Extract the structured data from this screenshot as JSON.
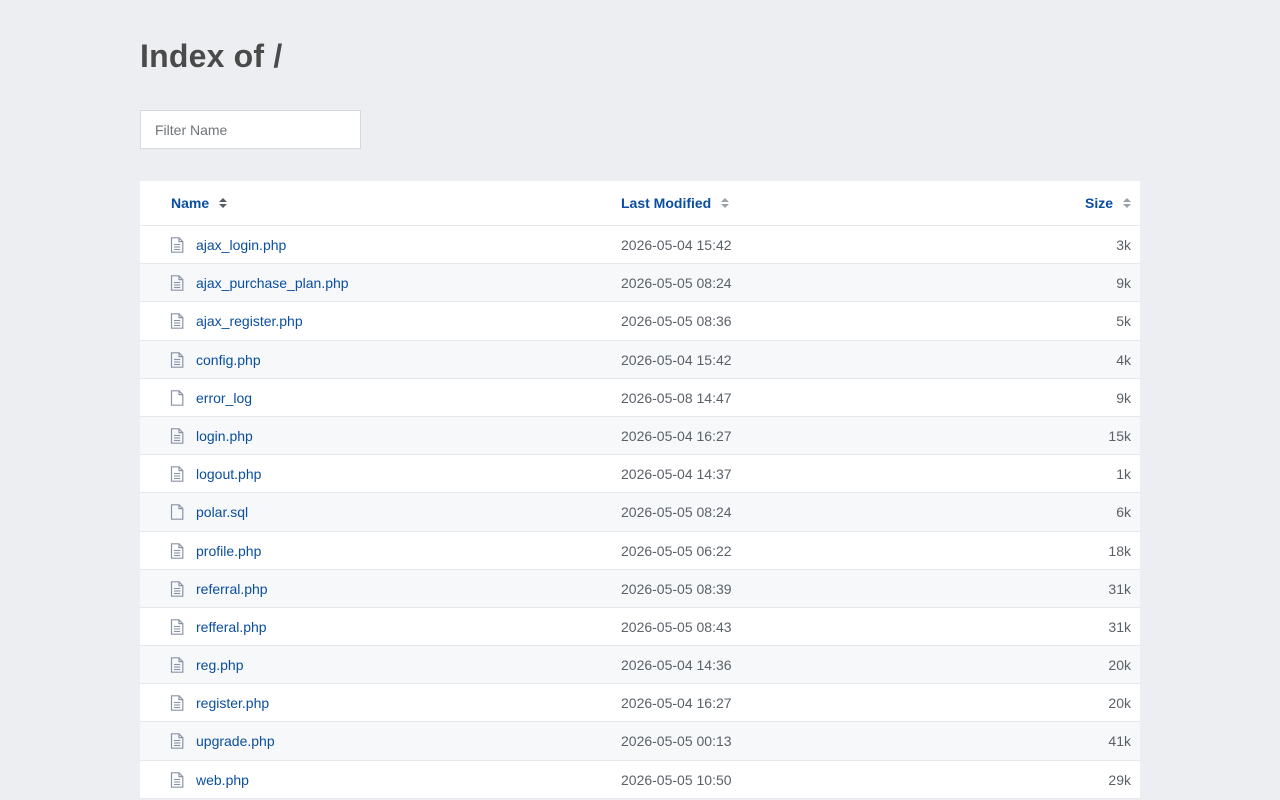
{
  "page": {
    "title": "Index of /"
  },
  "filter": {
    "placeholder": "Filter Name",
    "value": ""
  },
  "columns": {
    "name": "Name",
    "modified": "Last Modified",
    "size": "Size",
    "sorted_by": "name"
  },
  "files": [
    {
      "name": "ajax_login.php",
      "modified": "2026-05-04 15:42",
      "size": "3k",
      "icon": "file-text-icon"
    },
    {
      "name": "ajax_purchase_plan.php",
      "modified": "2026-05-05 08:24",
      "size": "9k",
      "icon": "file-text-icon"
    },
    {
      "name": "ajax_register.php",
      "modified": "2026-05-05 08:36",
      "size": "5k",
      "icon": "file-text-icon"
    },
    {
      "name": "config.php",
      "modified": "2026-05-04 15:42",
      "size": "4k",
      "icon": "file-text-icon"
    },
    {
      "name": "error_log",
      "modified": "2026-05-08 14:47",
      "size": "9k",
      "icon": "file-blank-icon"
    },
    {
      "name": "login.php",
      "modified": "2026-05-04 16:27",
      "size": "15k",
      "icon": "file-text-icon"
    },
    {
      "name": "logout.php",
      "modified": "2026-05-04 14:37",
      "size": "1k",
      "icon": "file-text-icon"
    },
    {
      "name": "polar.sql",
      "modified": "2026-05-05 08:24",
      "size": "6k",
      "icon": "file-blank-icon"
    },
    {
      "name": "profile.php",
      "modified": "2026-05-05 06:22",
      "size": "18k",
      "icon": "file-text-icon"
    },
    {
      "name": "referral.php",
      "modified": "2026-05-05 08:39",
      "size": "31k",
      "icon": "file-text-icon"
    },
    {
      "name": "refferal.php",
      "modified": "2026-05-05 08:43",
      "size": "31k",
      "icon": "file-text-icon"
    },
    {
      "name": "reg.php",
      "modified": "2026-05-04 14:36",
      "size": "20k",
      "icon": "file-text-icon"
    },
    {
      "name": "register.php",
      "modified": "2026-05-04 16:27",
      "size": "20k",
      "icon": "file-text-icon"
    },
    {
      "name": "upgrade.php",
      "modified": "2026-05-05 00:13",
      "size": "41k",
      "icon": "file-text-icon"
    },
    {
      "name": "web.php",
      "modified": "2026-05-05 10:50",
      "size": "29k",
      "icon": "file-text-icon"
    }
  ],
  "colors": {
    "link": "#0a4ea0",
    "background": "#eceef1",
    "icon": "#8a93a6"
  }
}
